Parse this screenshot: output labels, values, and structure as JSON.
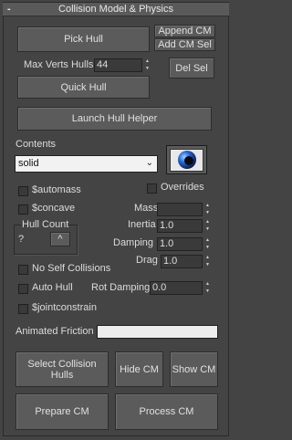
{
  "rollout": {
    "collapse_symbol": "-",
    "title": "Collision Model & Physics"
  },
  "buttons": {
    "pick_hull": "Pick Hull",
    "append_cm": "Append CM",
    "add_cm_sel": "Add CM Sel",
    "del_sel": "Del Sel",
    "quick_hull": "Quick Hull",
    "launch_hull_helper": "Launch Hull Helper",
    "select_collision_hulls": "Select Collision Hulls",
    "hide_cm": "Hide CM",
    "show_cm": "Show CM",
    "prepare_cm": "Prepare CM",
    "process_cm": "Process CM"
  },
  "max_verts_hulls": {
    "label": "Max Verts Hulls",
    "value": "44"
  },
  "contents": {
    "label": "Contents",
    "selected": "solid",
    "preview_icon": "eye-sphere-icon"
  },
  "checkboxes": {
    "automass": "$automass",
    "overrides": "Overrides",
    "concave": "$concave",
    "no_self_collisions": "No Self Collisions",
    "auto_hull": "Auto Hull",
    "jointconstrain": "$jointconstrain"
  },
  "hull_count": {
    "label": "Hull Count",
    "value": "?",
    "up_symbol": "^"
  },
  "physics": {
    "mass_label": "Mass",
    "mass_value": "",
    "inertia_label": "Inertia",
    "inertia_value": "1.0",
    "damping_label": "Damping",
    "damping_value": "1.0",
    "drag_label": "Drag",
    "drag_value": "1.0",
    "rot_damping_label": "Rot Damping",
    "rot_damping_value": "0.0"
  },
  "animated_friction": {
    "label": "Animated Friction",
    "value": ""
  },
  "colors": {
    "background": "#444444",
    "button": "#5b5b5b",
    "field": "#3a3a3a",
    "text": "#dcdcdc",
    "icon_blue": "#2a6ad8"
  }
}
